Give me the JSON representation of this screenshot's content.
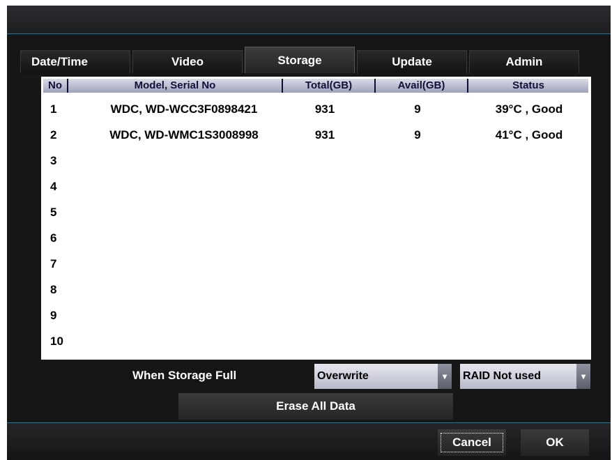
{
  "tabs": [
    {
      "label": "Date/Time",
      "active": false
    },
    {
      "label": "Video",
      "active": false
    },
    {
      "label": "Storage",
      "active": true
    },
    {
      "label": "Update",
      "active": false
    },
    {
      "label": "Admin",
      "active": false
    }
  ],
  "table": {
    "columns": [
      "No",
      "Model, Serial No",
      "Total(GB)",
      "Avail(GB)",
      "Status"
    ],
    "rows": [
      {
        "no": "1",
        "model": "WDC, WD-WCC3F0898421",
        "total": "931",
        "avail": "9",
        "status": "39°C , Good"
      },
      {
        "no": "2",
        "model": "WDC, WD-WMC1S3008998",
        "total": "931",
        "avail": "9",
        "status": "41°C , Good"
      },
      {
        "no": "3",
        "model": "",
        "total": "",
        "avail": "",
        "status": ""
      },
      {
        "no": "4",
        "model": "",
        "total": "",
        "avail": "",
        "status": ""
      },
      {
        "no": "5",
        "model": "",
        "total": "",
        "avail": "",
        "status": ""
      },
      {
        "no": "6",
        "model": "",
        "total": "",
        "avail": "",
        "status": ""
      },
      {
        "no": "7",
        "model": "",
        "total": "",
        "avail": "",
        "status": ""
      },
      {
        "no": "8",
        "model": "",
        "total": "",
        "avail": "",
        "status": ""
      },
      {
        "no": "9",
        "model": "",
        "total": "",
        "avail": "",
        "status": ""
      },
      {
        "no": "10",
        "model": "",
        "total": "",
        "avail": "",
        "status": ""
      }
    ]
  },
  "storage_full": {
    "label": "When Storage Full",
    "mode_value": "Overwrite",
    "raid_value": "RAID Not used"
  },
  "icons": {
    "dropdown_arrow": "chevron-down-icon",
    "dropdown_glyph": "▾"
  },
  "buttons": {
    "erase": "Erase All Data",
    "cancel": "Cancel",
    "ok": "OK"
  },
  "colors": {
    "accent_line": "#3a6f87",
    "header_text": "#10103a"
  }
}
